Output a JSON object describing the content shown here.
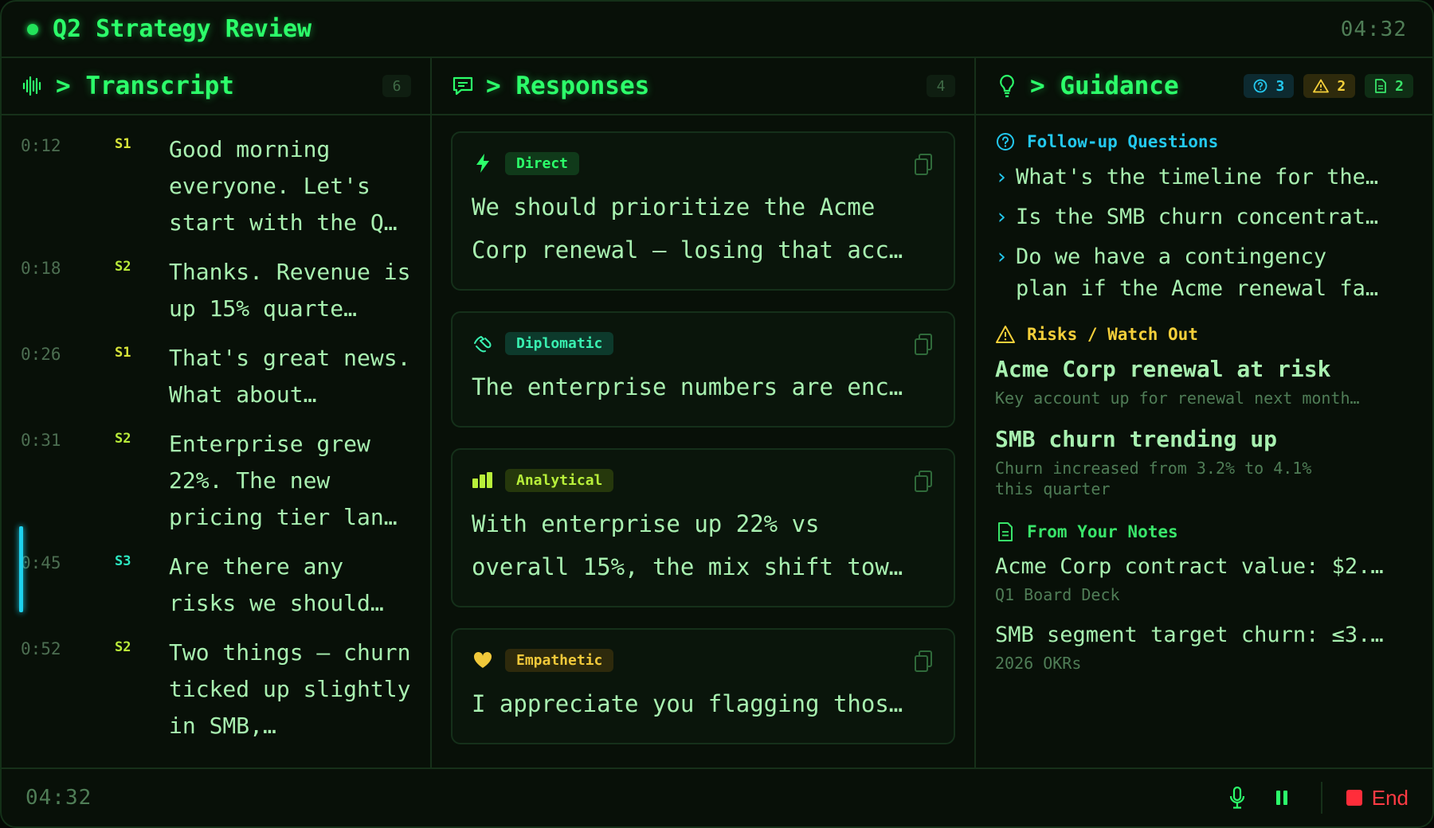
{
  "header": {
    "title": "Q2 Strategy Review",
    "clock": "04:32"
  },
  "transcript": {
    "title": "> Transcript",
    "count": "6",
    "rows": [
      {
        "time": "0:12",
        "speaker": "S1",
        "text": "Good morning everyone. Let's start with the Q…"
      },
      {
        "time": "0:18",
        "speaker": "S2",
        "text": "Thanks. Revenue is up 15% quarte…"
      },
      {
        "time": "0:26",
        "speaker": "S1",
        "text": "That's great news. What about…"
      },
      {
        "time": "0:31",
        "speaker": "S2",
        "text": "Enterprise grew 22%. The new pricing tier lan…"
      },
      {
        "time": "0:45",
        "speaker": "S3",
        "text": "Are there any risks we should…"
      },
      {
        "time": "0:52",
        "speaker": "S2",
        "text": "Two things — churn ticked up slightly in SMB,…"
      }
    ]
  },
  "responses": {
    "title": "> Responses",
    "count": "4",
    "cards": [
      {
        "tag": "Direct",
        "icon": "lightning-icon",
        "text": "We should prioritize the Acme\nCorp renewal — losing that acc…"
      },
      {
        "tag": "Diplomatic",
        "icon": "handshake-icon",
        "text": "The enterprise numbers are enc…"
      },
      {
        "tag": "Analytical",
        "icon": "bar-chart-icon",
        "text": "With enterprise up 22% vs\noverall 15%, the mix shift tow…"
      },
      {
        "tag": "Empathetic",
        "icon": "heart-icon",
        "text": "I appreciate you flagging thos…"
      }
    ]
  },
  "guidance": {
    "title": "> Guidance",
    "badges": {
      "questions": "3",
      "risks": "2",
      "notes": "2"
    },
    "questions_title": "Follow-up Questions",
    "questions": [
      "What's the timeline for the…",
      "Is the SMB churn concentrat…",
      "Do we have a contingency\nplan if the Acme renewal fa…"
    ],
    "risks_title": "Risks / Watch Out",
    "risks": [
      {
        "title": "Acme Corp renewal at risk",
        "detail": "Key account up for renewal next month…"
      },
      {
        "title": "SMB churn trending up",
        "detail": "Churn increased from 3.2% to 4.1%\nthis quarter"
      }
    ],
    "notes_title": "From Your Notes",
    "notes": [
      {
        "text": "Acme Corp contract value: $2.…",
        "source": "Q1 Board Deck"
      },
      {
        "text": "SMB segment target churn: ≤3.…",
        "source": "2026 OKRs"
      }
    ]
  },
  "footer": {
    "time": "04:32",
    "end_label": "End"
  },
  "colors": {
    "accent": "#2cff6a",
    "question": "#23c8ee",
    "risk": "#f5d03a",
    "end": "#ff2d3a"
  }
}
